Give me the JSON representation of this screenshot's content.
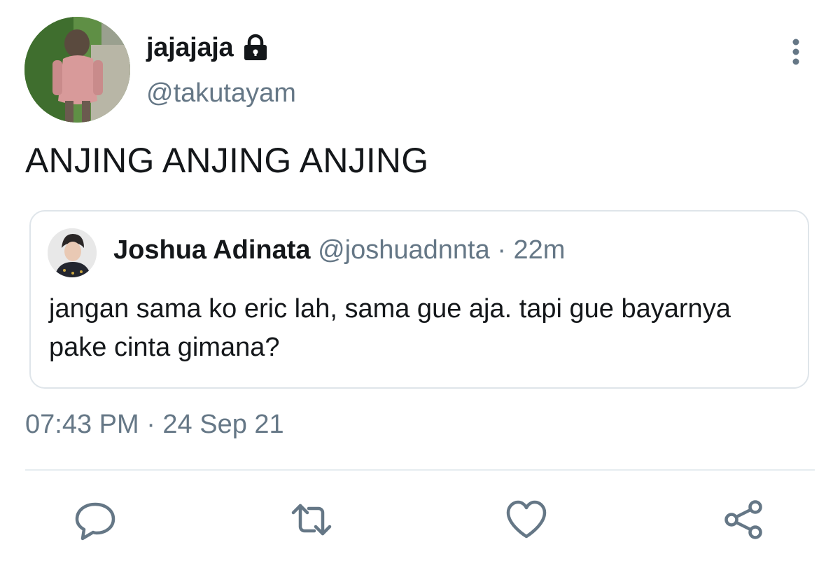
{
  "tweet": {
    "author": {
      "display_name": "jajajaja",
      "handle": "@takutayam",
      "protected": true
    },
    "text": "ANJING ANJING ANJING",
    "timestamp": "07:43 PM · 24 Sep 21"
  },
  "quoted_tweet": {
    "display_name": "Joshua Adinata",
    "handle": "@joshuadnnta",
    "separator": "·",
    "time": "22m",
    "text": "jangan sama ko eric lah, sama gue aja. tapi gue bayarnya pake cinta gimana?"
  },
  "actions": {
    "icons": [
      "reply-icon",
      "retweet-icon",
      "like-icon",
      "share-icon"
    ]
  },
  "colors": {
    "text_primary": "#14171a",
    "text_secondary": "#657786",
    "icon": "#657786",
    "border": "#dfe5ea"
  }
}
